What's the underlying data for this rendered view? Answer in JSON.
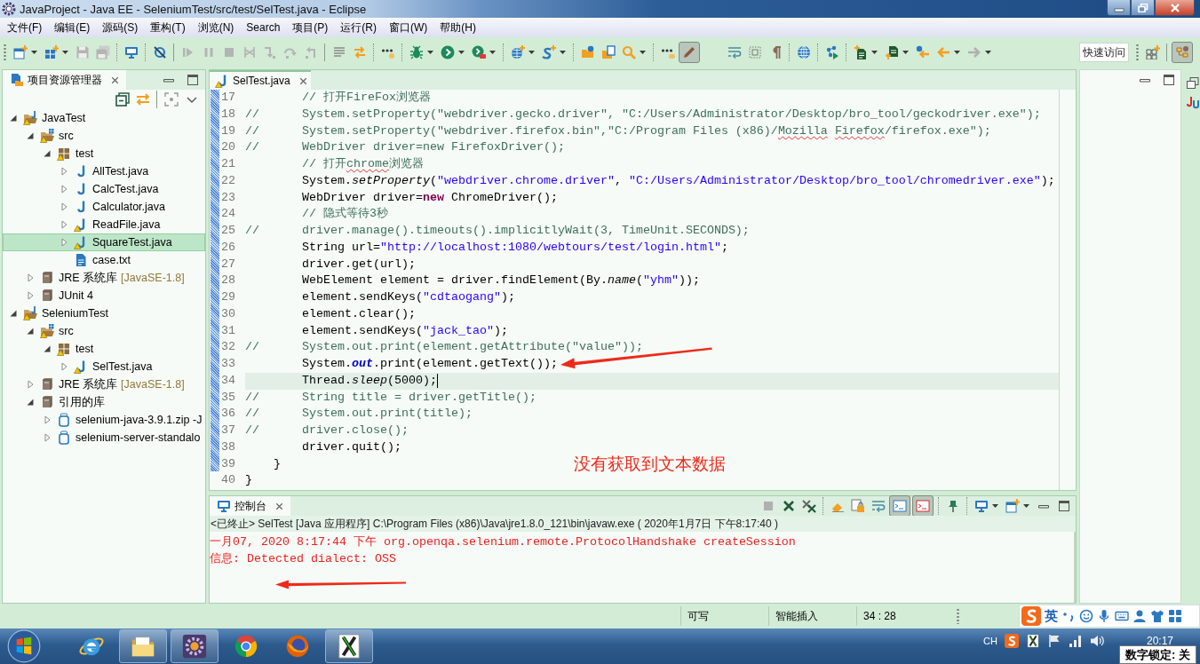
{
  "window": {
    "title": "JavaProject - Java EE - SeleniumTest/src/test/SelTest.java - Eclipse"
  },
  "menu": [
    "文件(F)",
    "编辑(E)",
    "源码(S)",
    "重构(T)",
    "浏览(N)",
    "Search",
    "项目(P)",
    "运行(R)",
    "窗口(W)",
    "帮助(H)"
  ],
  "toolbar": {
    "mark_occurrences": {
      "pressed": true
    },
    "quick_access": {
      "placeholder": "快速访问"
    },
    "perspective": {
      "selected": true
    }
  },
  "project_explorer": {
    "tab": {
      "label": "项目资源管理器",
      "selected": true
    },
    "tree": [
      {
        "label": "JavaTest",
        "kind": "project",
        "warning": true,
        "expanded": true,
        "selected": false,
        "children": [
          {
            "label": "src",
            "kind": "source_folder",
            "warning": true,
            "expanded": true,
            "selected": false,
            "children": [
              {
                "label": "test",
                "kind": "package",
                "warning": true,
                "expanded": true,
                "selected": false,
                "children": [
                  {
                    "label": "AllTest.java",
                    "kind": "java",
                    "warning": false,
                    "expanded": false,
                    "selected": false
                  },
                  {
                    "label": "CalcTest.java",
                    "kind": "java",
                    "warning": false,
                    "expanded": false,
                    "selected": false
                  },
                  {
                    "label": "Calculator.java",
                    "kind": "java",
                    "warning": false,
                    "expanded": false,
                    "selected": false
                  },
                  {
                    "label": "ReadFile.java",
                    "kind": "java",
                    "warning": true,
                    "expanded": false,
                    "selected": false
                  },
                  {
                    "label": "SquareTest.java",
                    "kind": "java",
                    "warning": true,
                    "expanded": false,
                    "selected": true
                  },
                  {
                    "label": "case.txt",
                    "kind": "text",
                    "warning": false,
                    "selected": false
                  }
                ]
              }
            ]
          },
          {
            "label": "JRE 系统库",
            "decoration": "[JavaSE-1.8]",
            "kind": "library",
            "warning": false,
            "expanded": false,
            "selected": false
          },
          {
            "label": "JUnit 4",
            "kind": "library",
            "warning": false,
            "expanded": false,
            "selected": false
          }
        ]
      },
      {
        "label": "SeleniumTest",
        "kind": "project",
        "warning": true,
        "expanded": true,
        "selected": false,
        "children": [
          {
            "label": "src",
            "kind": "source_folder",
            "warning": true,
            "expanded": true,
            "selected": false,
            "children": [
              {
                "label": "test",
                "kind": "package",
                "warning": true,
                "expanded": true,
                "selected": false,
                "children": [
                  {
                    "label": "SelTest.java",
                    "kind": "java",
                    "warning": true,
                    "expanded": false,
                    "selected": false
                  }
                ]
              }
            ]
          },
          {
            "label": "JRE 系统库",
            "decoration": "[JavaSE-1.8]",
            "kind": "library",
            "warning": false,
            "expanded": false,
            "selected": false
          },
          {
            "label": "引用的库",
            "kind": "library",
            "warning": false,
            "expanded": true,
            "selected": false,
            "children": [
              {
                "label": "selenium-java-3.9.1.zip -J",
                "kind": "jar",
                "warning": false,
                "expanded": false,
                "selected": false
              },
              {
                "label": "selenium-server-standalo",
                "kind": "jar",
                "warning": false,
                "expanded": false,
                "selected": false
              }
            ]
          }
        ]
      }
    ]
  },
  "editor": {
    "tabs": [
      {
        "label": "SelTest.java",
        "warning": true,
        "selected": true
      }
    ],
    "lines": [
      {
        "number": "17",
        "current": false,
        "tokens": [
          {
            "kind": "comment",
            "text": "        // 打开FireFox浏览器"
          }
        ]
      },
      {
        "number": "18",
        "current": false,
        "tokens": [
          {
            "kind": "comment",
            "text": "//      System.setProperty(\"webdriver.gecko.driver\", \"C:/Users/Administrator/Desktop/bro_tool/geckodriver.exe\");"
          }
        ]
      },
      {
        "number": "19",
        "current": false,
        "tokens": [
          {
            "kind": "comment",
            "text": "//      System.setProperty(\"webdriver.firefox.bin\",\"C:/Program Files (x86)/"
          },
          {
            "kind": "comment_misspelled",
            "text": "Mozilla Firefox"
          },
          {
            "kind": "comment",
            "text": "/firefox.exe\");"
          }
        ]
      },
      {
        "number": "20",
        "current": false,
        "tokens": [
          {
            "kind": "comment",
            "text": "//      WebDriver driver=new FirefoxDriver();"
          }
        ]
      },
      {
        "number": "21",
        "current": false,
        "tokens": [
          {
            "kind": "comment",
            "text": "        // 打开"
          },
          {
            "kind": "comment_misspelled",
            "text": "chrome"
          },
          {
            "kind": "comment",
            "text": "浏览器"
          }
        ]
      },
      {
        "number": "22",
        "current": false,
        "tokens": [
          {
            "kind": "plain",
            "text": "        System."
          },
          {
            "kind": "static_method",
            "text": "setProperty"
          },
          {
            "kind": "plain",
            "text": "("
          },
          {
            "kind": "string",
            "text": "\"webdriver.chrome.driver\""
          },
          {
            "kind": "plain",
            "text": ", "
          },
          {
            "kind": "string",
            "text": "\"C:/Users/Administrator/Desktop/bro_tool/chromedriver.exe\""
          },
          {
            "kind": "plain",
            "text": ");"
          }
        ]
      },
      {
        "number": "23",
        "current": false,
        "tokens": [
          {
            "kind": "plain",
            "text": "        WebDriver driver="
          },
          {
            "kind": "keyword",
            "text": "new"
          },
          {
            "kind": "plain",
            "text": " ChromeDriver();"
          }
        ]
      },
      {
        "number": "24",
        "current": false,
        "tokens": [
          {
            "kind": "comment",
            "text": "        // 隐式等待3秒"
          }
        ]
      },
      {
        "number": "25",
        "current": false,
        "tokens": [
          {
            "kind": "comment",
            "text": "//      driver.manage().timeouts().implicitlyWait(3, TimeUnit.SECONDS);"
          }
        ]
      },
      {
        "number": "26",
        "current": false,
        "tokens": [
          {
            "kind": "plain",
            "text": "        String url="
          },
          {
            "kind": "string",
            "text": "\"http://localhost:1080/webtours/test/login.html\""
          },
          {
            "kind": "plain",
            "text": ";"
          }
        ]
      },
      {
        "number": "27",
        "current": false,
        "tokens": [
          {
            "kind": "plain",
            "text": "        driver.get(url);"
          }
        ]
      },
      {
        "number": "28",
        "current": false,
        "tokens": [
          {
            "kind": "plain",
            "text": "        WebElement element = driver.findElement(By."
          },
          {
            "kind": "static_method",
            "text": "name"
          },
          {
            "kind": "plain",
            "text": "("
          },
          {
            "kind": "string",
            "text": "\"yhm\""
          },
          {
            "kind": "plain",
            "text": "));"
          }
        ]
      },
      {
        "number": "29",
        "current": false,
        "tokens": [
          {
            "kind": "plain",
            "text": "        element.sendKeys("
          },
          {
            "kind": "string",
            "text": "\"cdtaogang\""
          },
          {
            "kind": "plain",
            "text": ");"
          }
        ]
      },
      {
        "number": "30",
        "current": false,
        "tokens": [
          {
            "kind": "plain",
            "text": "        element.clear();"
          }
        ]
      },
      {
        "number": "31",
        "current": false,
        "tokens": [
          {
            "kind": "plain",
            "text": "        element.sendKeys("
          },
          {
            "kind": "string",
            "text": "\"jack_tao\""
          },
          {
            "kind": "plain",
            "text": ");"
          }
        ]
      },
      {
        "number": "32",
        "current": false,
        "tokens": [
          {
            "kind": "comment",
            "text": "//      System.out.print(element.getAttribute(\"value\"));"
          }
        ]
      },
      {
        "number": "33",
        "current": false,
        "tokens": [
          {
            "kind": "plain",
            "text": "        System."
          },
          {
            "kind": "static_field",
            "text": "out"
          },
          {
            "kind": "plain",
            "text": ".print(element.getText());"
          }
        ]
      },
      {
        "number": "34",
        "current": true,
        "tokens": [
          {
            "kind": "plain",
            "text": "        Thread."
          },
          {
            "kind": "static_method",
            "text": "sleep"
          },
          {
            "kind": "plain",
            "text": "(5000);"
          }
        ]
      },
      {
        "number": "35",
        "current": false,
        "tokens": [
          {
            "kind": "comment",
            "text": "//      String title = driver.getTitle();"
          }
        ]
      },
      {
        "number": "36",
        "current": false,
        "tokens": [
          {
            "kind": "comment",
            "text": "//      System.out.print(title);"
          }
        ]
      },
      {
        "number": "37",
        "current": false,
        "tokens": [
          {
            "kind": "comment",
            "text": "//      driver.close();"
          }
        ]
      },
      {
        "number": "38",
        "current": false,
        "tokens": [
          {
            "kind": "plain",
            "text": "        driver.quit();"
          }
        ]
      },
      {
        "number": "39",
        "current": false,
        "tokens": [
          {
            "kind": "plain",
            "text": "    }"
          }
        ]
      },
      {
        "number": "40",
        "current": false,
        "tokens": [
          {
            "kind": "plain",
            "text": "}"
          }
        ]
      }
    ],
    "note": "没有获取到文本数据"
  },
  "console": {
    "tab": {
      "label": "控制台",
      "selected": true
    },
    "toolbar": {
      "show_on_output": {
        "pressed": true
      },
      "show_on_error": {
        "pressed": true
      }
    },
    "process": "<已终止> SelTest [Java 应用程序] C:\\Program Files (x86)\\Java\\jre1.8.0_121\\bin\\javaw.exe ( 2020年1月7日 下午8:17:40 )",
    "output": [
      {
        "kind": "stderr",
        "text": "一月07, 2020 8:17:44 下午 org.openqa.selenium.remote.ProtocolHandshake createSession"
      },
      {
        "kind": "stderr",
        "text": "信息: Detected dialect: OSS"
      }
    ]
  },
  "status_bar": [
    "可写",
    "智能插入",
    "34 : 28"
  ],
  "ime_bar": {
    "mode": "英"
  },
  "taskbar": {
    "apps": [
      {
        "kind": "ie",
        "running": false
      },
      {
        "kind": "explorer",
        "running": true
      },
      {
        "kind": "javaee",
        "running": true
      },
      {
        "kind": "chrome",
        "running": false
      },
      {
        "kind": "firefox",
        "running": false
      },
      {
        "kind": "xmanager",
        "running": true
      }
    ],
    "tray": {
      "language": "CH",
      "clock": "20:17"
    }
  },
  "numlock_popup": "数字锁定: 关"
}
